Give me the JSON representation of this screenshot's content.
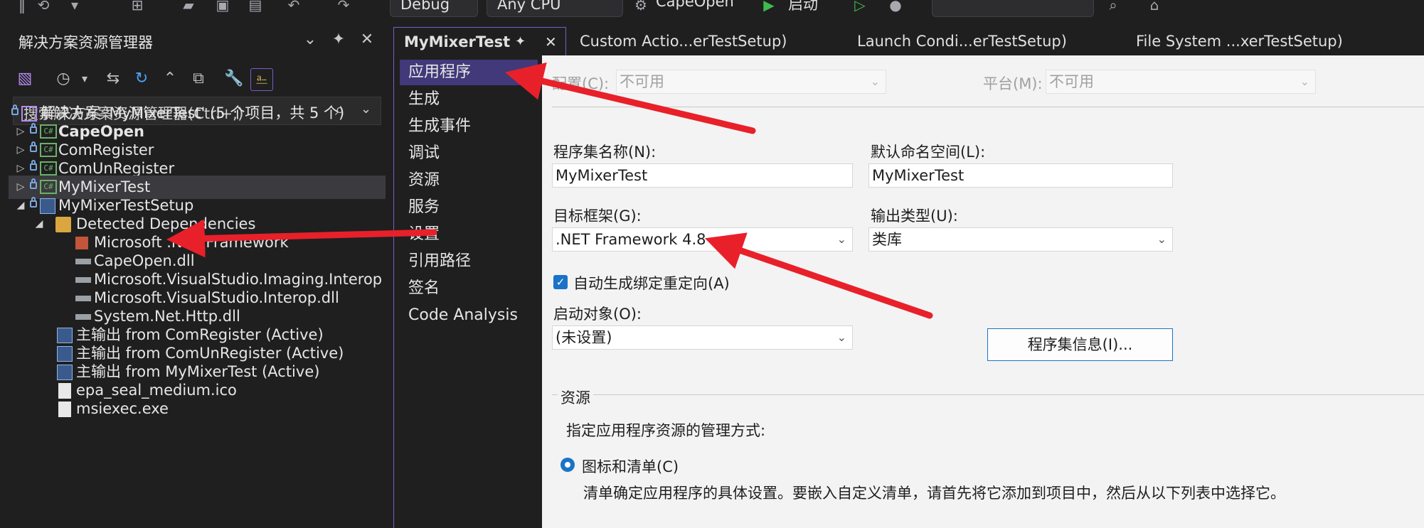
{
  "toolbar": {
    "config": "Debug",
    "platform": "Any CPU",
    "startup_project": "CapeOpen",
    "start_label": "启动"
  },
  "solution_explorer": {
    "title": "解决方案资源管理器",
    "search_placeholder": "搜索解决方案资源管理器(Ctrl+;)",
    "solution": "解决方案 'MyMixerTest' (5 个项目，共 5 个)",
    "projects": [
      {
        "label": "CapeOpen"
      },
      {
        "label": "ComRegister"
      },
      {
        "label": "ComUnRegister"
      },
      {
        "label": "MyMixerTest"
      },
      {
        "label": "MyMixerTestSetup"
      }
    ],
    "detected_dependencies": "Detected Dependencies",
    "dependencies": [
      "Microsoft .NET Framework",
      "CapeOpen.dll",
      "Microsoft.VisualStudio.Imaging.Interop",
      "Microsoft.VisualStudio.Interop.dll",
      "System.Net.Http.dll"
    ],
    "outputs": [
      "主输出 from ComRegister (Active)",
      "主输出 from ComUnRegister (Active)",
      "主输出 from MyMixerTest (Active)"
    ],
    "files": [
      "epa_seal_medium.ico",
      "msiexec.exe"
    ]
  },
  "tabs": [
    {
      "label": "MyMixerTest"
    },
    {
      "label": "Custom Actio...erTestSetup)"
    },
    {
      "label": "Launch Condi...erTestSetup)"
    },
    {
      "label": "File System ...xerTestSetup)"
    }
  ],
  "nav": [
    "应用程序",
    "生成",
    "生成事件",
    "调试",
    "资源",
    "服务",
    "设置",
    "引用路径",
    "签名",
    "Code Analysis"
  ],
  "app_page": {
    "config_label": "配置(C):",
    "config_value": "不可用",
    "platform_label": "平台(M):",
    "platform_value": "不可用",
    "assembly_name_label": "程序集名称(N):",
    "assembly_name": "MyMixerTest",
    "default_namespace_label": "默认命名空间(L):",
    "default_namespace": "MyMixerTest",
    "target_framework_label": "目标框架(G):",
    "target_framework": ".NET Framework 4.8",
    "output_type_label": "输出类型(U):",
    "output_type": "类库",
    "auto_binding_label": "自动生成绑定重定向(A)",
    "startup_object_label": "启动对象(O):",
    "startup_object": "(未设置)",
    "assembly_info_button": "程序集信息(I)...",
    "resources_group": "资源",
    "resources_desc": "指定应用程序资源的管理方式:",
    "icon_manifest_label": "图标和清单(C)",
    "manifest_desc": "清单确定应用程序的具体设置。要嵌入自定义清单，请首先将它添加到项目中，然后从以下列表中选择它。"
  },
  "colors": {
    "accent": "#7a5cc7",
    "selection": "#413979",
    "arrow": "#e8202a"
  }
}
